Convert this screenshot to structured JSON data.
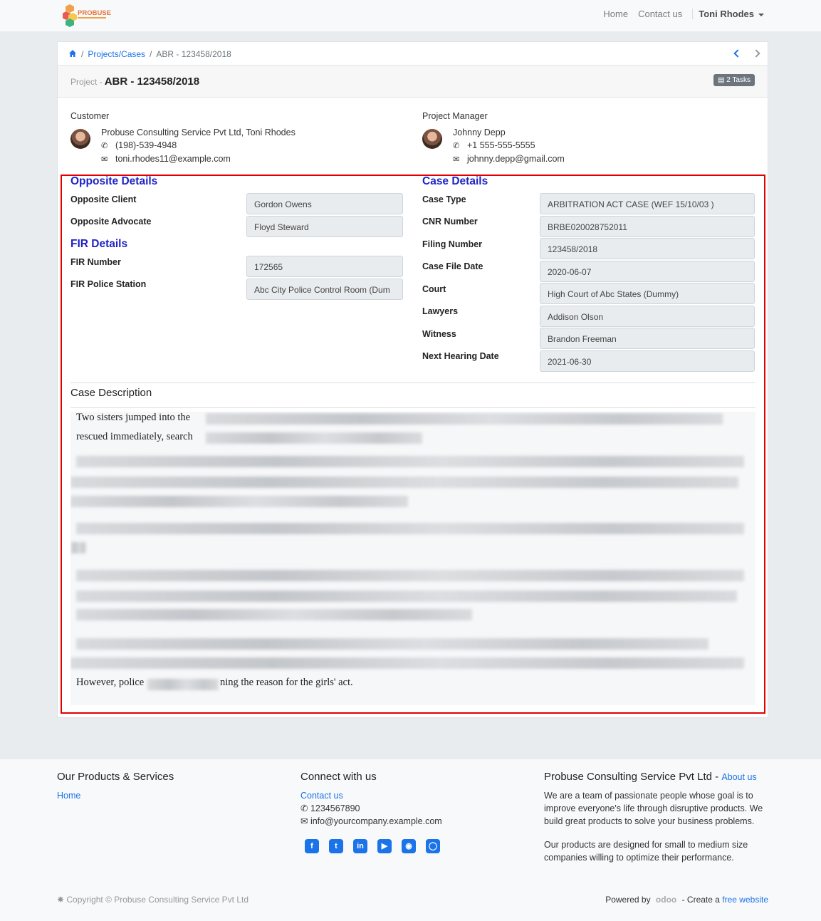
{
  "nav": {
    "brand": "PROBUSE",
    "home": "Home",
    "contact": "Contact us",
    "user": "Toni Rhodes"
  },
  "breadcrumb": {
    "link": "Projects/Cases",
    "current": "ABR - 123458/2018"
  },
  "header": {
    "label": "Project -",
    "title": "ABR - 123458/2018",
    "tasks": "2 Tasks"
  },
  "customer": {
    "label": "Customer",
    "name": "Probuse Consulting Service Pvt Ltd, Toni Rhodes",
    "phone": "(198)-539-4948",
    "email": "toni.rhodes11@example.com"
  },
  "manager": {
    "label": "Project Manager",
    "name": "Johnny Depp",
    "phone": "+1 555-555-5555",
    "email": "johnny.depp@gmail.com"
  },
  "opposite": {
    "heading": "Opposite Details",
    "client_label": "Opposite Client",
    "client": "Gordon Owens",
    "advocate_label": "Opposite Advocate",
    "advocate": "Floyd Steward"
  },
  "fir": {
    "heading": "FIR Details",
    "number_label": "FIR Number",
    "number": "172565",
    "station_label": "FIR Police Station",
    "station": "Abc City Police Control Room (Dum"
  },
  "case": {
    "heading": "Case Details",
    "type_label": "Case Type",
    "type": "ARBITRATION ACT CASE (WEF 15/10/03 )",
    "cnr_label": "CNR Number",
    "cnr": "BRBE020028752011",
    "filing_label": "Filing Number",
    "filing": "123458/2018",
    "date_label": "Case File Date",
    "date": "2020-06-07",
    "court_label": "Court",
    "court": "High Court of Abc States (Dummy)",
    "lawyers_label": "Lawyers",
    "lawyers": "Addison Olson",
    "witness_label": "Witness",
    "witness": "Brandon Freeman",
    "hearing_label": "Next Hearing Date",
    "hearing": "2021-06-30"
  },
  "description": {
    "title": "Case Description",
    "line1": "Two sisters jumped into the",
    "line2": "rescued immediately, search",
    "last_a": "However, police",
    "last_b": "ning the reason for the girls' act."
  },
  "footer": {
    "col1_title": "Our Products & Services",
    "col1_link": "Home",
    "col2_title": "Connect with us",
    "col2_link": "Contact us",
    "phone": "1234567890",
    "email": "info@yourcompany.example.com",
    "col3_title": "Probuse Consulting Service Pvt Ltd",
    "col3_link": "About us",
    "about1": "We are a team of passionate people whose goal is to improve everyone's life through disruptive products. We build great products to solve your business problems.",
    "about2": "Our products are designed for small to medium size companies willing to optimize their performance.",
    "copyright": "Copyright © Probuse Consulting Service Pvt Ltd",
    "powered": "Powered by",
    "odoo": "odoo",
    "create": "- Create a",
    "free_site": "free website"
  },
  "colors": {
    "accent": "#1a73e8",
    "heading": "#1f23c4",
    "highlight": "#e00000"
  }
}
